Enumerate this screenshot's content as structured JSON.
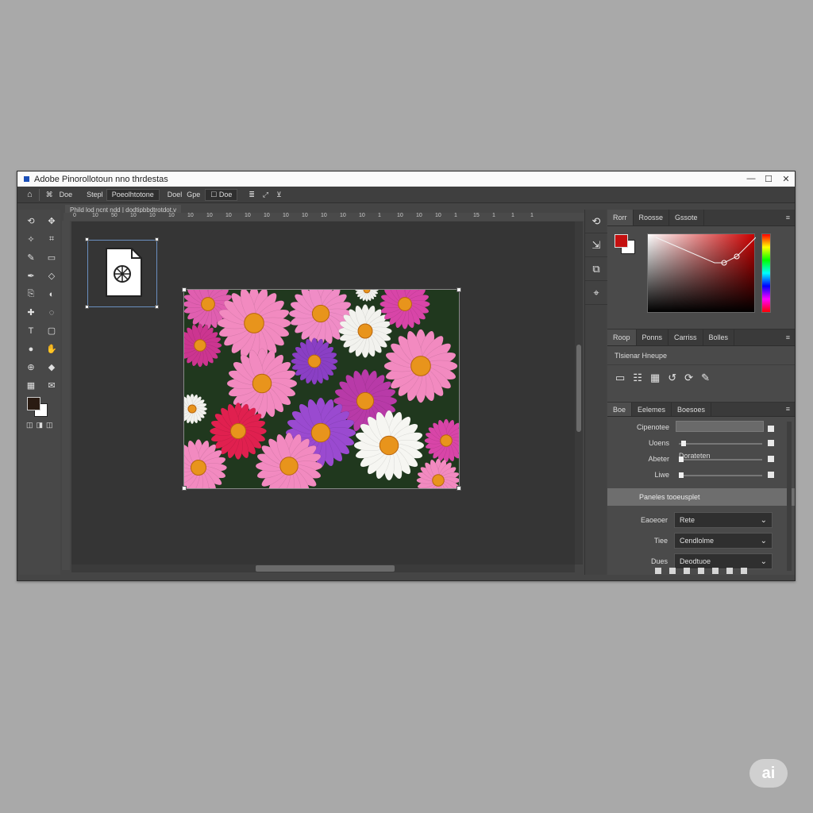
{
  "window": {
    "title": "Adobe Pinorollotoun nno thrdestas",
    "controls": [
      "—",
      "☐",
      "✕"
    ]
  },
  "options_bar": {
    "home_icon": "home-icon",
    "items": [
      "Doe",
      "Stepl",
      "Poeolhtotone",
      "Doel",
      "Gpe",
      "Doe"
    ]
  },
  "document_tab": {
    "label": "Phild lod ncnt ndd | dodtipbbdtrotdot.v"
  },
  "ruler": {
    "ticks": [
      "0",
      "10",
      "50",
      "10",
      "10",
      "10",
      "10",
      "10",
      "10",
      "10",
      "10",
      "10",
      "10",
      "10",
      "10",
      "10",
      "1",
      "10",
      "10",
      "10",
      "1",
      "15",
      "1",
      "1",
      "1"
    ]
  },
  "toolbar": {
    "tools": [
      "lasso-icon",
      "move-icon",
      "magic-wand-icon",
      "crop-icon",
      "brush-icon",
      "marquee-icon",
      "pen-icon",
      "eraser-icon",
      "clone-icon",
      "gradient-icon",
      "healing-icon",
      "blur-icon",
      "type-icon",
      "select-icon",
      "dodge-icon",
      "hand-icon",
      "zoom-icon",
      "shape-icon",
      "grid-icon",
      "note-icon"
    ],
    "foreground_color": "#2a1b12",
    "background_color": "#ffffff",
    "modes": [
      "◫",
      "◨",
      "◫"
    ]
  },
  "dock": {
    "icons": [
      "history-icon",
      "adjust-icon",
      "layers-icon",
      "properties-icon"
    ]
  },
  "color_panel": {
    "tabs": [
      "Rorr",
      "Roosse",
      "Gssote"
    ],
    "foreground_color": "#c41010",
    "background_color": "#ffffff"
  },
  "library_panel": {
    "tabs": [
      "Roop",
      "Ponns",
      "Carriss",
      "Bolles"
    ],
    "label": "Tlsienar Hneupe",
    "icons": [
      "rectangle-icon",
      "table-icon",
      "grid-icon",
      "curve-icon",
      "refresh-icon",
      "paint-icon"
    ]
  },
  "props_panel": {
    "tabs": [
      "Boe",
      "Eelemes",
      "Boesoes"
    ],
    "rows": [
      {
        "label": "Cipenotee",
        "type": "field"
      },
      {
        "label": "Uoens",
        "type": "slider",
        "value": 0.03
      },
      {
        "label": "Abeter",
        "sublabel": "Dorateten",
        "type": "slider",
        "value": 0.0
      },
      {
        "label": "Liwe",
        "type": "slider",
        "value": 0.0
      }
    ],
    "section_label": "Paneles   tooeusplet",
    "dropdowns": [
      {
        "label": "Eaoeoer",
        "value": "Rete"
      },
      {
        "label": "Tiee",
        "value": "Cendlolme"
      },
      {
        "label": "Dues",
        "value": "Deodtuoe"
      }
    ]
  },
  "watermark": "ai"
}
